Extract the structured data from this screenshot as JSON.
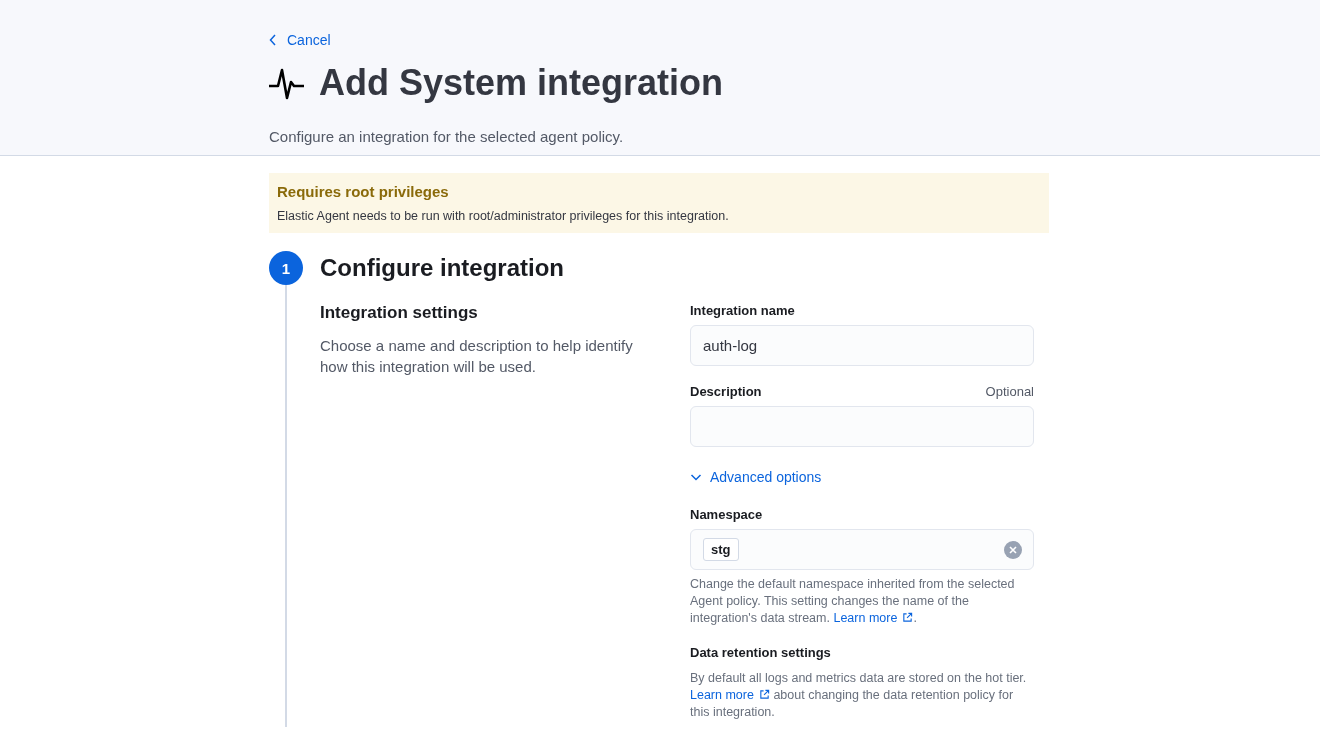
{
  "header": {
    "back_link": "Cancel",
    "title": "Add System integration",
    "subtitle": "Configure an integration for the selected agent policy."
  },
  "callout": {
    "title": "Requires root privileges",
    "text": "Elastic Agent needs to be run with root/administrator privileges for this integration."
  },
  "step": {
    "number": "1",
    "title": "Configure integration"
  },
  "settings": {
    "title": "Integration settings",
    "description": "Choose a name and description to help identify how this integration will be used."
  },
  "fields": [
    {
      "label": "Integration name",
      "value": "auth-log"
    },
    {
      "label": "Description",
      "optional": "Optional"
    }
  ],
  "advanced": {
    "label": "Advanced options",
    "expanded": true
  },
  "namespace": {
    "label": "Namespace",
    "chip": "stg",
    "help_before": "Change the default namespace inherited from the selected Agent policy. This setting changes the name of the integration's data stream.",
    "link": "Learn more",
    "help_after": "."
  },
  "retention": {
    "title": "Data retention settings",
    "help_before": "By default all logs and metrics data are stored on the hot tier.",
    "link": "Learn more",
    "help_after": "about changing the data retention policy for this integration."
  }
}
